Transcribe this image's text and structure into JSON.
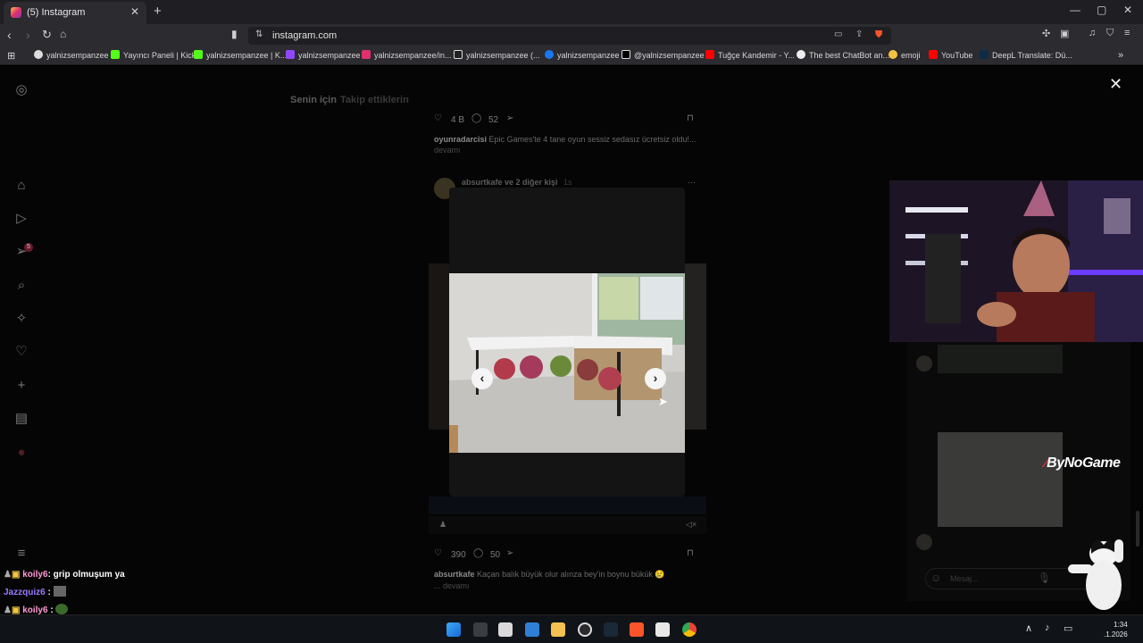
{
  "browser": {
    "tab_title": "(5) Instagram",
    "url": "instagram.com",
    "bookmarks": [
      "yalnizsempanzee",
      "Yayıncı Paneli | Kick",
      "yalnizsempanzee | K...",
      "yalnizsempanzee",
      "yalnizsempanzee/in...",
      "yalnizsempanzee (...",
      "yalnizsempanzee",
      "@yalnizsempanzee",
      "Tuğçe Kandemir - Y...",
      "The best ChatBot an...",
      "emoji",
      "YouTube",
      "DeepL Translate: Dü..."
    ]
  },
  "feed": {
    "tab_for_you": "Senin için",
    "tab_following": "Takip ettiklerin",
    "post1": {
      "likes": "4 B",
      "comments": "52",
      "user": "oyunradarcisi",
      "caption": "Epic Games'te 4 tane oyun sessiz sedasız ücretsiz oldu!...",
      "more": "devamı"
    },
    "post2": {
      "header_user": "absurtkafe ve 2 diğer kişi",
      "time": "1s",
      "likes": "390",
      "comments": "50",
      "user": "absurtkafe",
      "caption": "Kaçan balık büyük olur alınza bey'in boynu bükük 😢",
      "more": "... devamı"
    }
  },
  "sidebar_badge": "5",
  "overlay": {
    "brand": "ByNoGame",
    "dm_placeholder": "Mesaj...",
    "chat": [
      {
        "user": "koily6",
        "text": "grip olmuşum ya"
      },
      {
        "user": "Jazzquiz6",
        "text": ""
      },
      {
        "user": "koily6",
        "text": ""
      }
    ]
  },
  "clock": {
    "time": "1:34",
    "date": ".1.2026"
  },
  "colors": {
    "accent": "#e1306c",
    "page_bg": "#050505"
  }
}
